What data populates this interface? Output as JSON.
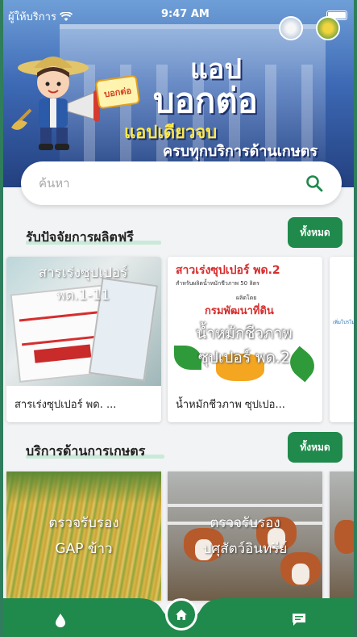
{
  "status_bar": {
    "carrier": "ผู้ให้บริการ",
    "time": "9:47 AM"
  },
  "banner": {
    "line1": "แอป",
    "line2": "บอกต่อ",
    "line3": "แอปเดียวจบ",
    "line4": "ครบทุกบริการด้านเกษตร",
    "bubble": "บอกต่อ"
  },
  "search": {
    "placeholder": "ค้นหา",
    "icon": "search-icon"
  },
  "free_inputs": {
    "title": "รับปัจจัยการผลิตฟรี",
    "view_all": "ทั้งหมด",
    "items": [
      {
        "overlay": "สารเร่งซุปเปอร์ พด.1-11",
        "caption": "สารเร่งซุปเปอร์ พด. ..."
      },
      {
        "overlay": "น้ำหมักชีวภาพ ซุปเปอร์ พด.2",
        "caption": "น้ำหมักชีวภาพ ซุปเปอ...",
        "poster_head": "สาวเร่งซุปเปอร์ พด.2",
        "poster_sub": "สำหรับผลิตน้ำหมักชีวภาพ 50 ลิตร",
        "poster_by": "ผลิตโดย",
        "poster_org": "กรมพัฒนาที่ดิน"
      },
      {
        "overlay": "",
        "caption": "",
        "peek": "เพิ่มโปรโม"
      }
    ]
  },
  "services": {
    "title": "บริการด้านการเกษตร",
    "view_all": "ทั้งหมด",
    "items": [
      {
        "overlay1": "ตรวจรับรอง",
        "overlay2": "GAP ข้าว"
      },
      {
        "overlay1": "ตรวจรับรอง",
        "overlay2": "ปศุสัตว์อินทรีย์"
      }
    ]
  },
  "bottom_nav": {
    "items": [
      "drop-icon",
      "home-icon",
      "chat-icon"
    ]
  },
  "colors": {
    "accent": "#1f8a4c",
    "frame": "#2f7d5c",
    "background": "#f2f3f5"
  }
}
